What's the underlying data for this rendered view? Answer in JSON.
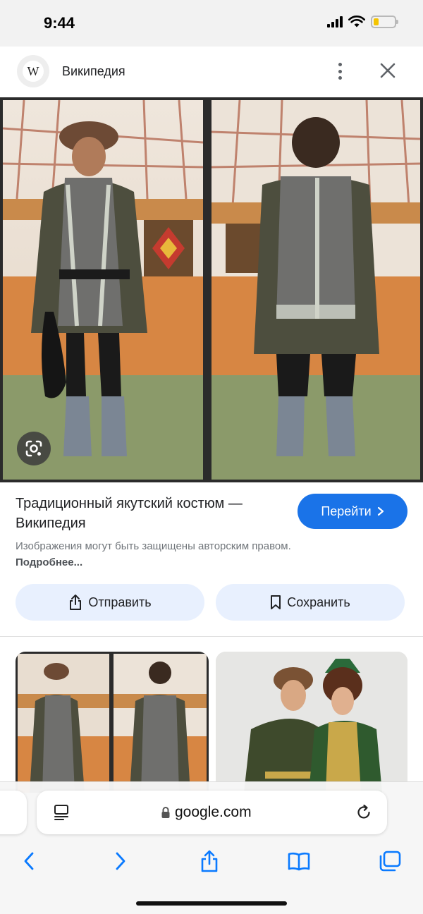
{
  "status_bar": {
    "time": "9:44",
    "signal_icon": "signal-bars-icon",
    "wifi_icon": "wifi-icon",
    "battery_icon": "battery-low-icon",
    "battery_level": 0.25,
    "battery_color": "#f4c400"
  },
  "header": {
    "site_logo_letter": "W",
    "site_name": "Википедия",
    "menu_icon": "more-vertical-icon",
    "close_icon": "close-icon"
  },
  "result": {
    "title": "Традиционный якутский костюм — Википедия",
    "goto_label": "Перейти",
    "goto_icon": "chevron-right-icon",
    "copyright_text": "Изображения могут быть защищены авторским правом.",
    "more_link": "Подробнее...",
    "lens_icon": "google-lens-icon"
  },
  "actions": {
    "share_label": "Отправить",
    "share_icon": "share-icon",
    "save_label": "Сохранить",
    "save_icon": "bookmark-icon"
  },
  "browser": {
    "url": "google.com",
    "lock_icon": "lock-icon",
    "reader_icon": "reader-mode-icon",
    "reload_icon": "reload-icon",
    "toolbar_icons": [
      "back-icon",
      "forward-icon",
      "share-icon",
      "bookmarks-icon",
      "tabs-icon"
    ],
    "accent_color": "#1a73e8"
  },
  "colors": {
    "primary_button": "#1a73e8",
    "action_button_bg": "#e8f0fe",
    "ios_blue": "#0a7aff"
  }
}
